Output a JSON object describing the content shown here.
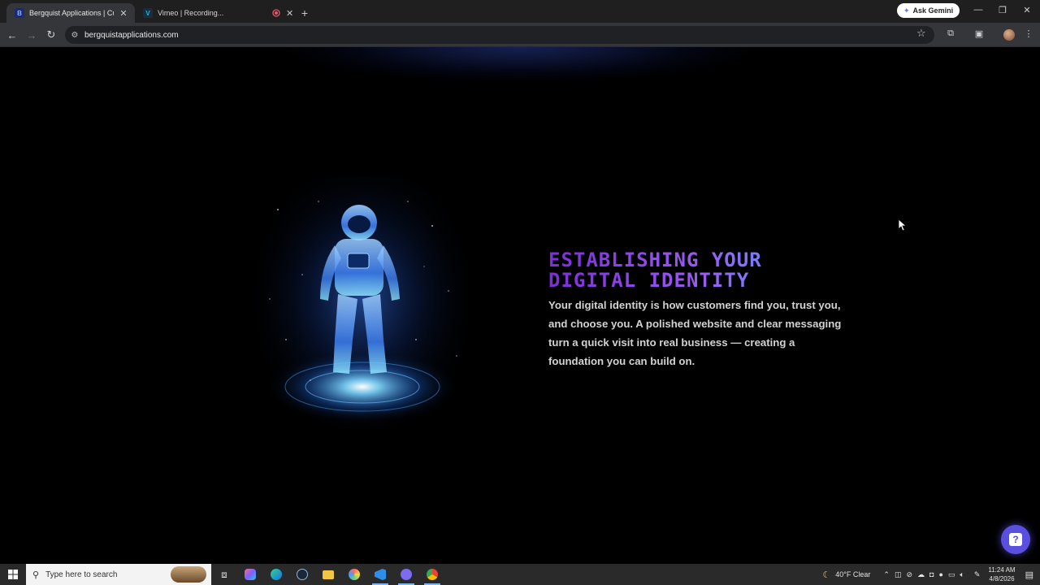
{
  "browser": {
    "tabs": [
      {
        "title": "Bergquist Applications | Custom",
        "favicon": "B",
        "active": true
      },
      {
        "title": "Vimeo | Recording...",
        "favicon": "V",
        "active": false
      },
      {
        "title": "",
        "favicon": "record",
        "active": false
      }
    ],
    "new_tab_label": "+",
    "ask_gemini": "Ask Gemini",
    "url": "bergquistapplications.com"
  },
  "page": {
    "heading_line1": "Establishing your",
    "heading_line2": "digital identity",
    "paragraph": "Your digital identity is how customers find you, trust you, and choose you. A polished website and clear messaging turn a quick visit into real business — creating a foundation you can build on.",
    "help_label": "?"
  },
  "taskbar": {
    "search_placeholder": "Type here to search",
    "weather": "40°F  Clear",
    "time": "11:24 AM",
    "date": "4/8/2026"
  },
  "colors": {
    "heading_start": "#7b2fd6",
    "heading_end": "#5aa0ff",
    "help_button": "#5b4fe0",
    "page_bg": "#000000"
  }
}
